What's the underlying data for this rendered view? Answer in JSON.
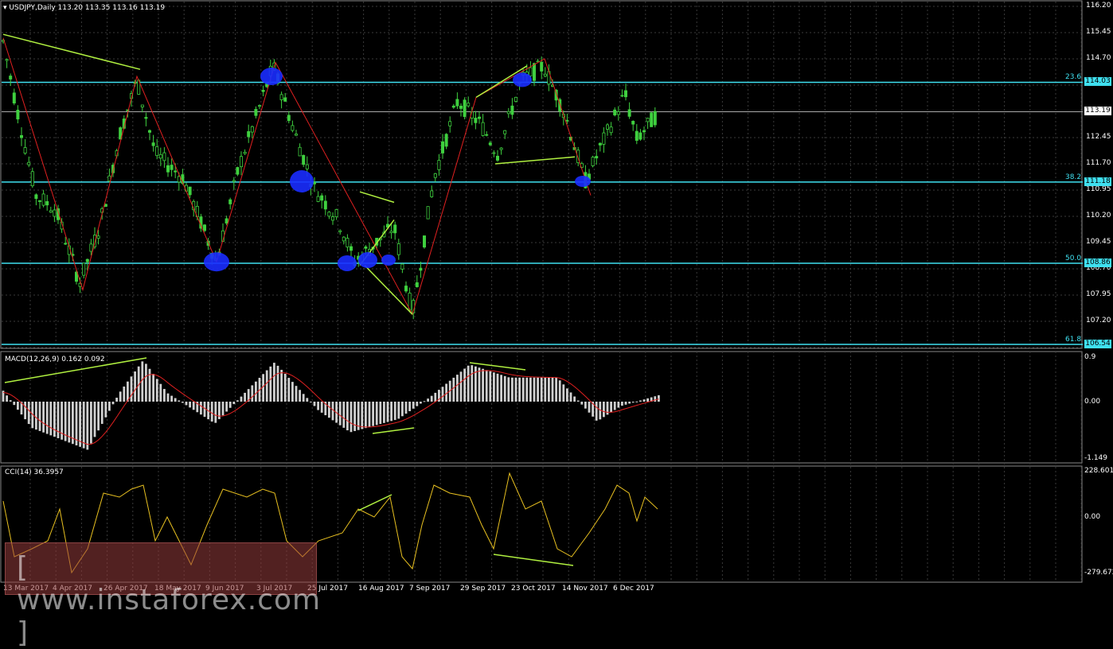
{
  "header": {
    "symbol": "USDJPY,Daily",
    "ohlc": "113.20 113.35 113.16 113.19"
  },
  "current_price": "113.19",
  "price_axis": [
    "116.20",
    "115.45",
    "114.70",
    "113.95",
    "113.19",
    "112.45",
    "111.70",
    "110.95",
    "110.20",
    "109.45",
    "108.70",
    "107.95",
    "107.20",
    "106.45"
  ],
  "fib_levels": [
    {
      "ratio": "23.6",
      "price": "114.03"
    },
    {
      "ratio": "38.2",
      "price": "111.18"
    },
    {
      "ratio": "50.0",
      "price": "108.86"
    },
    {
      "ratio": "61.8",
      "price": "106.54"
    }
  ],
  "macd": {
    "title": "MACD(12,26,9) 0.162 0.092",
    "axis": [
      "0.9",
      "0.00",
      "-1.149"
    ]
  },
  "cci": {
    "title": "CCI(14) 36.3957",
    "axis": [
      "228.6017",
      "0.00",
      "-279.672"
    ]
  },
  "dates": [
    "13 Mar 2017",
    "4 Apr 2017",
    "26 Apr 2017",
    "18 May 2017",
    "9 Jun 2017",
    "3 Jul 2017",
    "25 Jul 2017",
    "16 Aug 2017",
    "7 Sep 2017",
    "29 Sep 2017",
    "23 Oct 2017",
    "14 Nov 2017",
    "6 Dec 2017"
  ],
  "watermark": "[ www.instaforex.com ]",
  "colors": {
    "fib": "#3fe0f0",
    "candle": "#3fd03f",
    "zigzag": "#e02020",
    "trend": "#b0f040",
    "circle": "#1a2cff",
    "cci": "#e8c020"
  }
}
